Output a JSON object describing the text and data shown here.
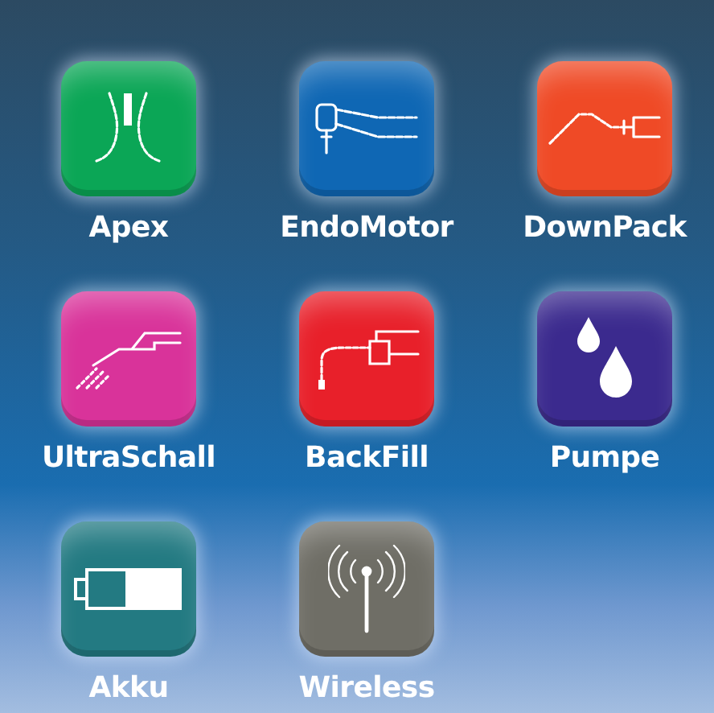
{
  "tiles": [
    {
      "label": "Apex",
      "kind": "apex",
      "color": "#0ba656"
    },
    {
      "label": "EndoMotor",
      "kind": "motor",
      "color": "#0f67b4"
    },
    {
      "label": "DownPack",
      "kind": "downpack",
      "color": "#ef4a26"
    },
    {
      "label": "UltraSchall",
      "kind": "ultrasonic",
      "color": "#d9339a"
    },
    {
      "label": "BackFill",
      "kind": "backfill",
      "color": "#e8202a"
    },
    {
      "label": "Pumpe",
      "kind": "pump",
      "color": "#3b2a8e"
    },
    {
      "label": "Akku",
      "kind": "battery",
      "color": "#237a82"
    },
    {
      "label": "Wireless",
      "kind": "wireless",
      "color": "#6f6e66"
    }
  ]
}
